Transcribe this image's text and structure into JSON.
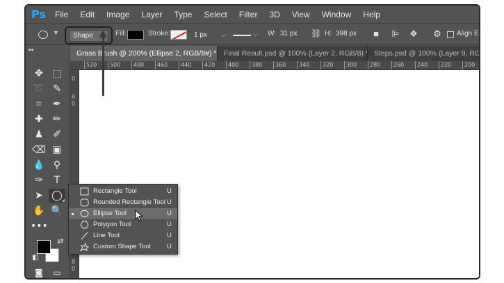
{
  "app": {
    "logo_text": "Ps",
    "accent_color": "#31a8ff"
  },
  "menu": [
    "File",
    "Edit",
    "Image",
    "Layer",
    "Type",
    "Select",
    "Filter",
    "3D",
    "View",
    "Window",
    "Help"
  ],
  "options_bar": {
    "mode_value": "Shape",
    "fill_label": "Fill:",
    "fill_color": "#000000",
    "stroke_label": "Stroke:",
    "stroke_width": "1 px",
    "w_label": "W:",
    "w_value": "31 px",
    "h_label": "H:",
    "h_value": "398 px",
    "align_edges_label": "Align Ed"
  },
  "tabs": [
    {
      "label": "Grass Brush @ 200% (Ellipse 2, RGB/8#) *",
      "active": true
    },
    {
      "label": "Final Result.psd @ 100% (Layer 2, RGB/8) *",
      "active": false
    },
    {
      "label": "Steps.psd @ 100% (Layer 9, RGB/",
      "active": false
    }
  ],
  "ruler_top": [
    "520",
    "500",
    "480",
    "460",
    "440",
    "420",
    "400",
    "380",
    "360",
    "340",
    "320",
    "300",
    "280",
    "260",
    "240",
    "220",
    "200"
  ],
  "ruler_left": [
    "0",
    "6",
    "0",
    "8",
    "0"
  ],
  "toolbox": {
    "collapse_label": "◂◂",
    "foreground_color": "#000000",
    "background_color": "#ffffff"
  },
  "shape_flyout": [
    {
      "label": "Rectangle Tool",
      "key": "U",
      "icon": "rectangle-icon",
      "selected": false
    },
    {
      "label": "Rounded Rectangle Tool",
      "key": "U",
      "icon": "rounded-rectangle-icon",
      "selected": false
    },
    {
      "label": "Ellipse Tool",
      "key": "U",
      "icon": "ellipse-icon",
      "selected": true
    },
    {
      "label": "Polygon Tool",
      "key": "U",
      "icon": "polygon-icon",
      "selected": false
    },
    {
      "label": "Line Tool",
      "key": "U",
      "icon": "line-icon",
      "selected": false
    },
    {
      "label": "Custom Shape Tool",
      "key": "U",
      "icon": "custom-shape-icon",
      "selected": false
    }
  ]
}
